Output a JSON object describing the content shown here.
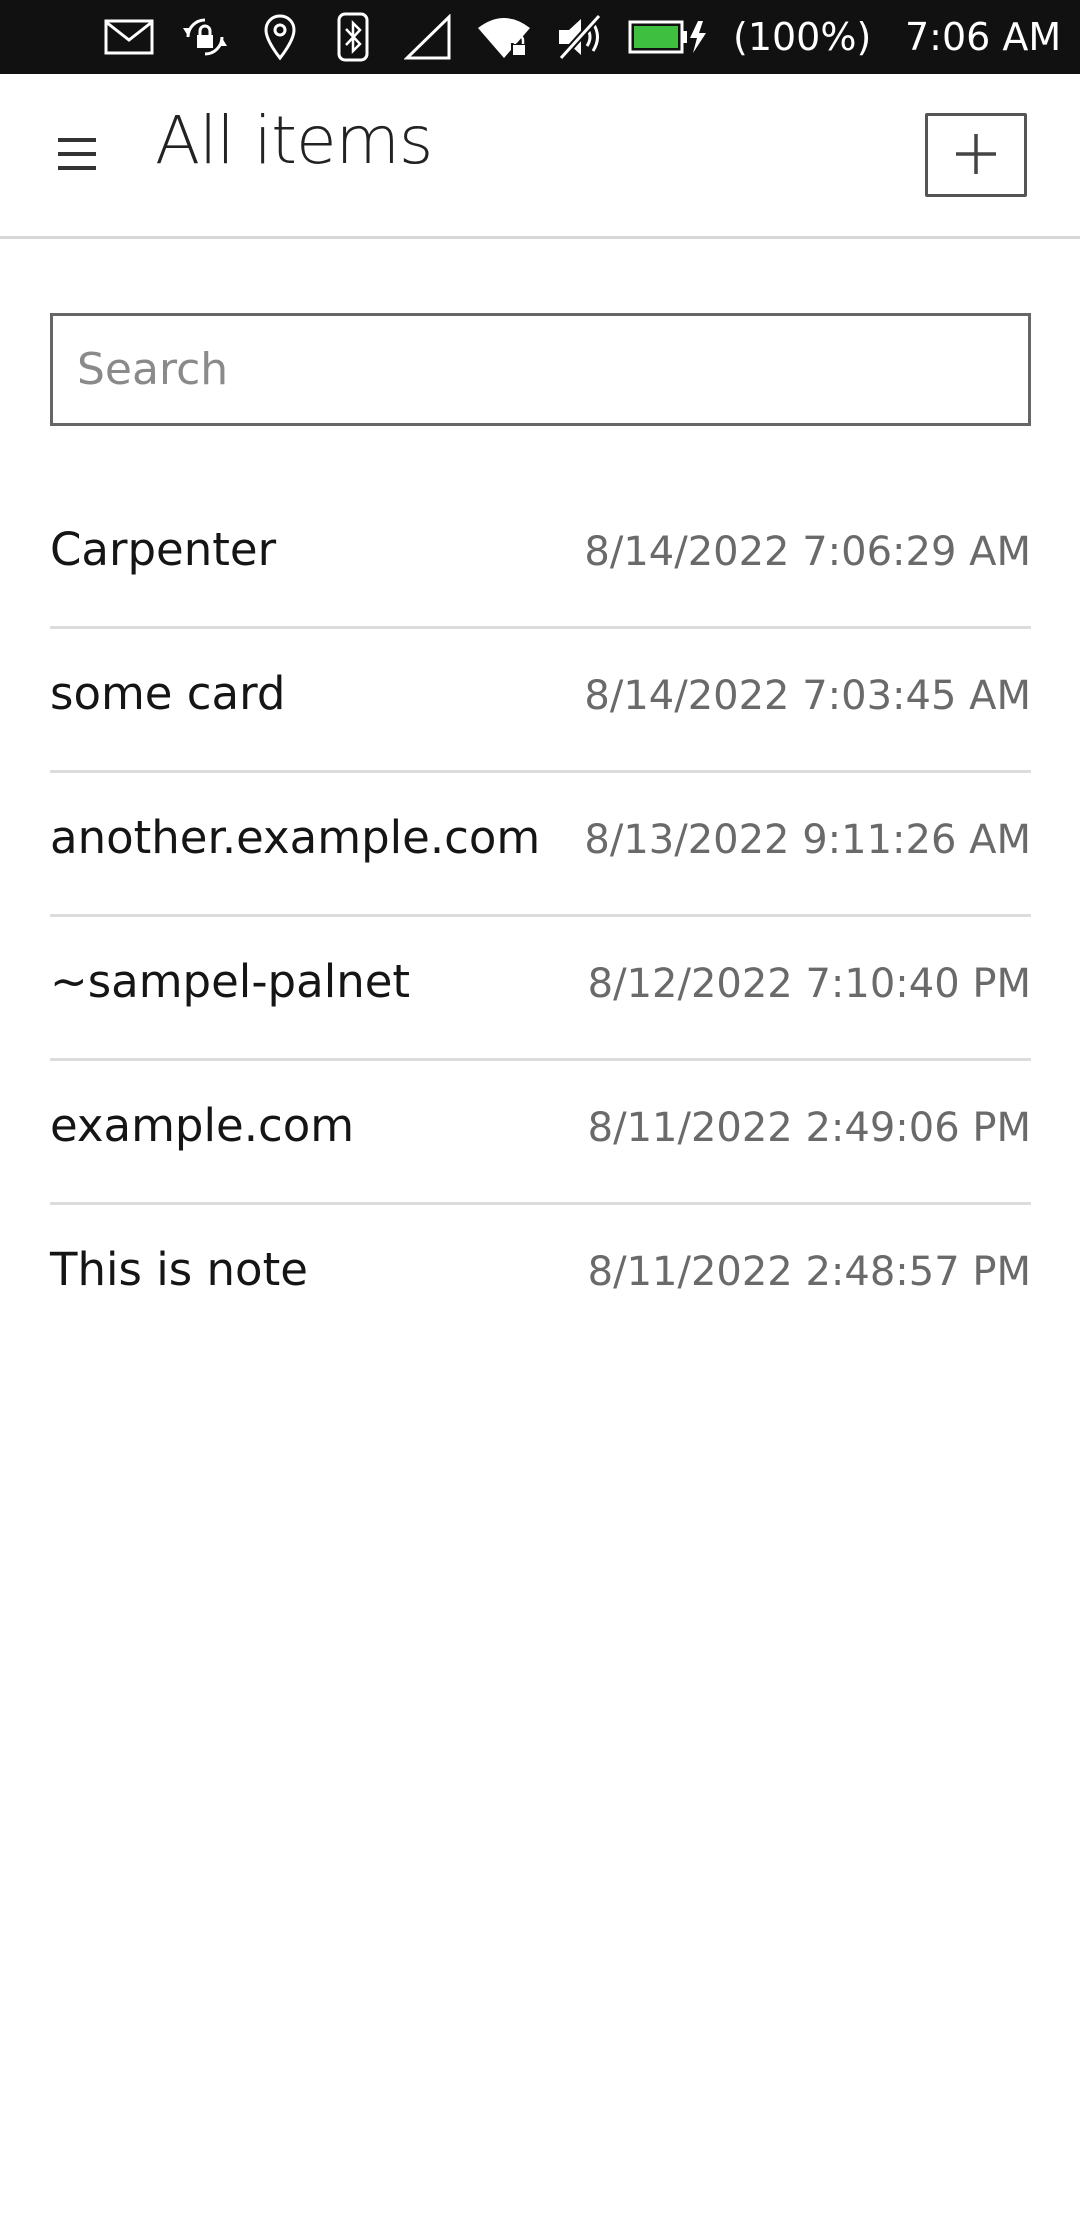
{
  "status_bar": {
    "battery_text": "(100%)",
    "time": "7:06 AM",
    "icons": [
      "mail-icon",
      "rotation-lock-icon",
      "location-icon",
      "bluetooth-icon",
      "signal-icon",
      "wifi-icon",
      "muted-icon",
      "battery-charging-icon"
    ],
    "battery_color": "#3fbf3f"
  },
  "header": {
    "title": "All items",
    "menu_icon": "hamburger-icon",
    "add_icon": "plus-icon"
  },
  "search": {
    "placeholder": "Search",
    "value": ""
  },
  "items": [
    {
      "title": "Carpenter",
      "date": "8/14/2022 7:06:29 AM"
    },
    {
      "title": "some card",
      "date": "8/14/2022 7:03:45 AM"
    },
    {
      "title": "another.example.com",
      "date": "8/13/2022 9:11:26 AM"
    },
    {
      "title": "~sampel-palnet",
      "date": "8/12/2022 7:10:40 PM"
    },
    {
      "title": "example.com",
      "date": "8/11/2022 2:49:06 PM"
    },
    {
      "title": "This is note",
      "date": "8/11/2022 2:48:57 PM"
    }
  ]
}
